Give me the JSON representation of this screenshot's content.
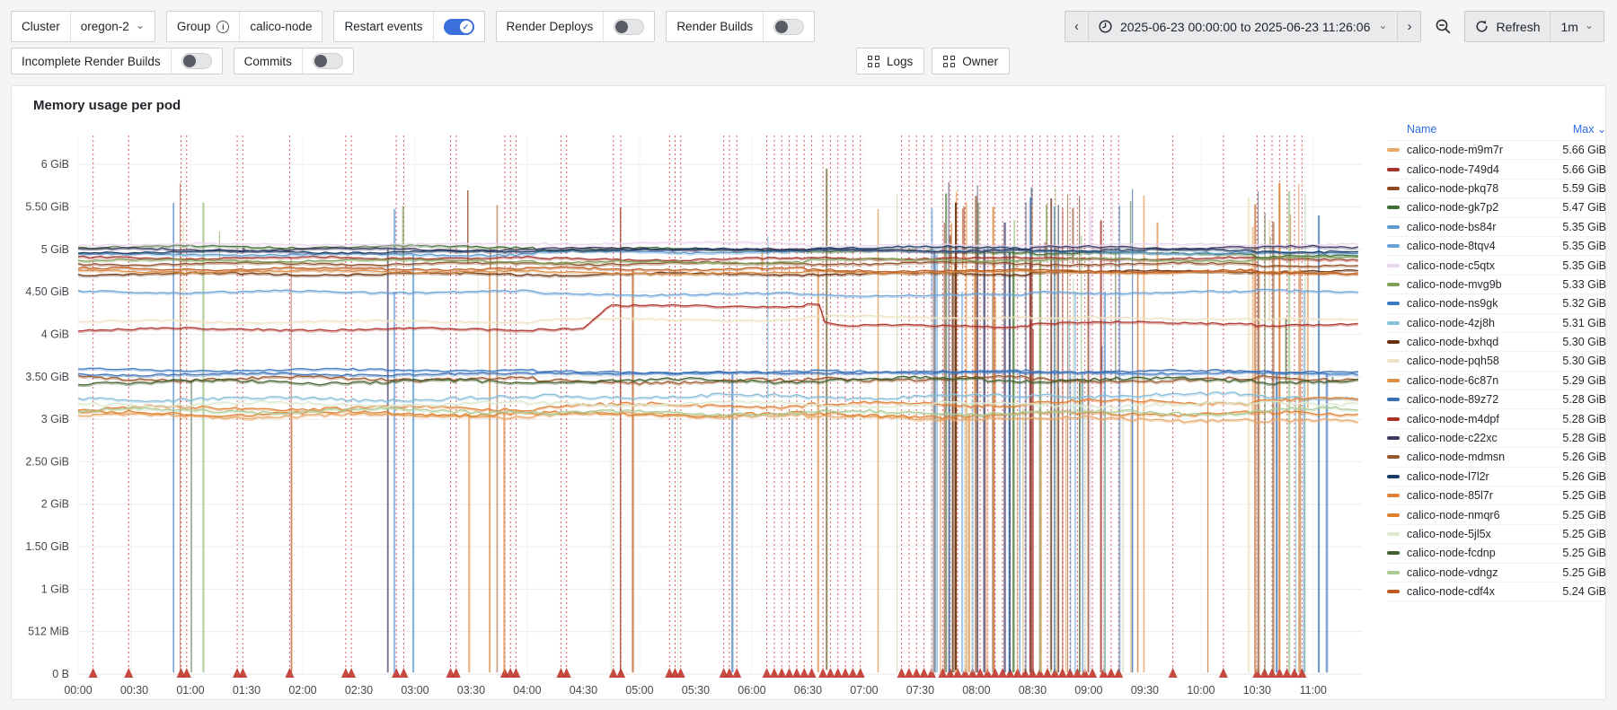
{
  "icons": {
    "chevron_down": "⌄",
    "chevron_left": "‹",
    "chevron_right": "›",
    "info": "i",
    "check": "✓",
    "sort_caret": "⌄"
  },
  "colors": {
    "accent_blue": "#3b6fd9",
    "link_blue": "#2e6be5",
    "annotation_red": "#d23f44",
    "triangle_red": "#c23a30",
    "page_bg": "#f5f5f6",
    "panel_bg": "#ffffff",
    "border": "#cfd0d3",
    "text": "#1e2328",
    "tick_text": "#44474d"
  },
  "toolbar": {
    "cluster_label": "Cluster",
    "cluster_value": "oregon-2",
    "group_label": "Group",
    "group_value": "calico-node",
    "toggles": [
      {
        "label": "Restart events",
        "on": true
      },
      {
        "label": "Render Deploys",
        "on": false
      },
      {
        "label": "Render Builds",
        "on": false
      },
      {
        "label": "Incomplete Render Builds",
        "on": false
      },
      {
        "label": "Commits",
        "on": false
      }
    ],
    "logs_label": "Logs",
    "owner_label": "Owner",
    "time_range": "2025-06-23 00:00:00 to 2025-06-23 11:26:06",
    "refresh_label": "Refresh",
    "interval_value": "1m"
  },
  "panel": {
    "title": "Memory usage per pod"
  },
  "legend": {
    "name_header": "Name",
    "max_header": "Max"
  },
  "chart_data": {
    "type": "line",
    "title": "Memory usage per pod",
    "x_ticks": [
      "00:00",
      "00:30",
      "01:00",
      "01:30",
      "02:00",
      "02:30",
      "03:00",
      "03:30",
      "04:00",
      "04:30",
      "05:00",
      "05:30",
      "06:00",
      "06:30",
      "07:00",
      "07:30",
      "08:00",
      "08:30",
      "09:00",
      "09:30",
      "10:00",
      "10:30",
      "11:00"
    ],
    "x_range_minutes": 686,
    "y_ticks": [
      "0 B",
      "512 MiB",
      "1 GiB",
      "1.50 GiB",
      "2 GiB",
      "2.50 GiB",
      "3 GiB",
      "3.50 GiB",
      "4 GiB",
      "4.50 GiB",
      "5 GiB",
      "5.50 GiB",
      "6 GiB"
    ],
    "y_tick_step_gib": 0.5,
    "ylim": [
      0,
      6.34
    ],
    "grid": true,
    "legend_position": "right",
    "series": [
      {
        "name": "calico-node-m9m7r",
        "max": "5.66 GiB",
        "color": "#e8a868",
        "base": 3.04
      },
      {
        "name": "calico-node-749d4",
        "max": "5.66 GiB",
        "color": "#a5352c",
        "base": 4.9
      },
      {
        "name": "calico-node-pkq78",
        "max": "5.59 GiB",
        "color": "#8f4a24",
        "base": 4.83
      },
      {
        "name": "calico-node-gk7p2",
        "max": "5.47 GiB",
        "color": "#3f6e33",
        "base": 5.03
      },
      {
        "name": "calico-node-bs84r",
        "max": "5.35 GiB",
        "color": "#5b9bd3",
        "base": 4.94
      },
      {
        "name": "calico-node-8tqv4",
        "max": "5.35 GiB",
        "color": "#6aa3d8",
        "base": 4.5
      },
      {
        "name": "calico-node-c5qtx",
        "max": "5.35 GiB",
        "color": "#e9d7ec",
        "base": 5.06
      },
      {
        "name": "calico-node-mvg9b",
        "max": "5.33 GiB",
        "color": "#7f9e58",
        "base": 4.87
      },
      {
        "name": "calico-node-ns9gk",
        "max": "5.32 GiB",
        "color": "#3c7ac2",
        "base": 3.58
      },
      {
        "name": "calico-node-4zj8h",
        "max": "5.31 GiB",
        "color": "#85bcd8",
        "base": 3.24
      },
      {
        "name": "calico-node-bxhqd",
        "max": "5.30 GiB",
        "color": "#66300e",
        "base": 4.71
      },
      {
        "name": "calico-node-pqh58",
        "max": "5.30 GiB",
        "color": "#eee3c4",
        "base": 4.15
      },
      {
        "name": "calico-node-6c87n",
        "max": "5.29 GiB",
        "color": "#d98e44",
        "base": 4.74
      },
      {
        "name": "calico-node-89z72",
        "max": "5.28 GiB",
        "color": "#3a70b5",
        "base": 3.53
      },
      {
        "name": "calico-node-m4dpf",
        "max": "5.28 GiB",
        "color": "#ac3128",
        "base": 4.06,
        "step_from_min": 270,
        "step_to_min": 398,
        "step_level": 4.32
      },
      {
        "name": "calico-node-c22xc",
        "max": "5.28 GiB",
        "color": "#413a66",
        "base": 5.0
      },
      {
        "name": "calico-node-mdmsn",
        "max": "5.26 GiB",
        "color": "#99552b",
        "base": 3.48
      },
      {
        "name": "calico-node-l7l2r",
        "max": "5.26 GiB",
        "color": "#1d3c63",
        "base": 4.97
      },
      {
        "name": "calico-node-85l7r",
        "max": "5.25 GiB",
        "color": "#e07f33",
        "base": 3.13
      },
      {
        "name": "calico-node-nmqr6",
        "max": "5.25 GiB",
        "color": "#e0812e",
        "base": 3.07
      },
      {
        "name": "calico-node-5jl5x",
        "max": "5.25 GiB",
        "color": "#dcead0",
        "base": 3.18
      },
      {
        "name": "calico-node-fcdnp",
        "max": "5.25 GiB",
        "color": "#40602c",
        "base": 3.44
      },
      {
        "name": "calico-node-vdngz",
        "max": "5.25 GiB",
        "color": "#abcb95",
        "base": 3.1
      },
      {
        "name": "calico-node-cdf4x",
        "max": "5.24 GiB",
        "color": "#bf5c1d",
        "base": 4.77
      }
    ],
    "annotations_min": [
      8,
      27,
      55,
      58,
      85,
      88,
      113,
      143,
      146,
      170,
      174,
      199,
      202,
      228,
      231,
      234,
      258,
      261,
      286,
      290,
      316,
      319,
      322,
      345,
      348,
      352,
      368,
      372,
      376,
      380,
      384,
      388,
      392,
      398,
      402,
      406,
      410,
      414,
      418,
      440,
      444,
      448,
      452,
      456,
      462,
      466,
      470,
      474,
      478,
      482,
      486,
      490,
      494,
      498,
      502,
      506,
      510,
      514,
      518,
      522,
      526,
      530,
      534,
      538,
      542,
      548,
      552,
      556,
      585,
      612,
      630,
      634,
      638,
      642,
      646,
      650,
      654
    ],
    "spike_regions": [
      {
        "from_min": 5,
        "to_min": 680,
        "count": 45
      },
      {
        "from_min": 455,
        "to_min": 565,
        "count": 95
      },
      {
        "from_min": 625,
        "to_min": 658,
        "count": 22
      }
    ],
    "tall_spikes": [
      {
        "min": 400,
        "color": "#8a7a52",
        "top": 5.95
      },
      {
        "min": 469,
        "color": "#66300e",
        "top": 5.55
      },
      {
        "min": 489,
        "color": "#d98e44",
        "top": 5.5
      },
      {
        "min": 520,
        "color": "#8c564b",
        "top": 5.6
      },
      {
        "min": 642,
        "color": "#e07f33",
        "top": 5.78
      }
    ]
  }
}
